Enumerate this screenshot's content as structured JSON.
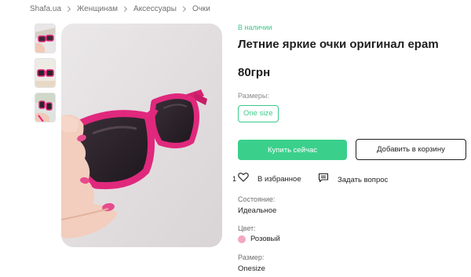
{
  "breadcrumb": {
    "items": [
      "Shafa.ua",
      "Женщинам",
      "Аксессуары",
      "Очки"
    ]
  },
  "product": {
    "stock_status": "В наличии",
    "title": "Летние яркие очки оригинал epam",
    "price": "80грн",
    "sizes_label": "Размеры:",
    "size_option": "One size"
  },
  "actions": {
    "buy_label": "Купить сейчас",
    "cart_label": "Добавить в корзину",
    "favorite_count": "1",
    "favorite_label": "В избранное",
    "ask_label": "Задать вопрос"
  },
  "specs": {
    "condition_label": "Состояние:",
    "condition_value": "Идеальное",
    "color_label": "Цвет:",
    "color_value": "Розовый",
    "size_label": "Размер:",
    "size_value": "Onesize"
  },
  "colors": {
    "accent": "#3ad08c",
    "swatch_pink": "#f2a9bf",
    "frame_pink": "#e0287d"
  }
}
